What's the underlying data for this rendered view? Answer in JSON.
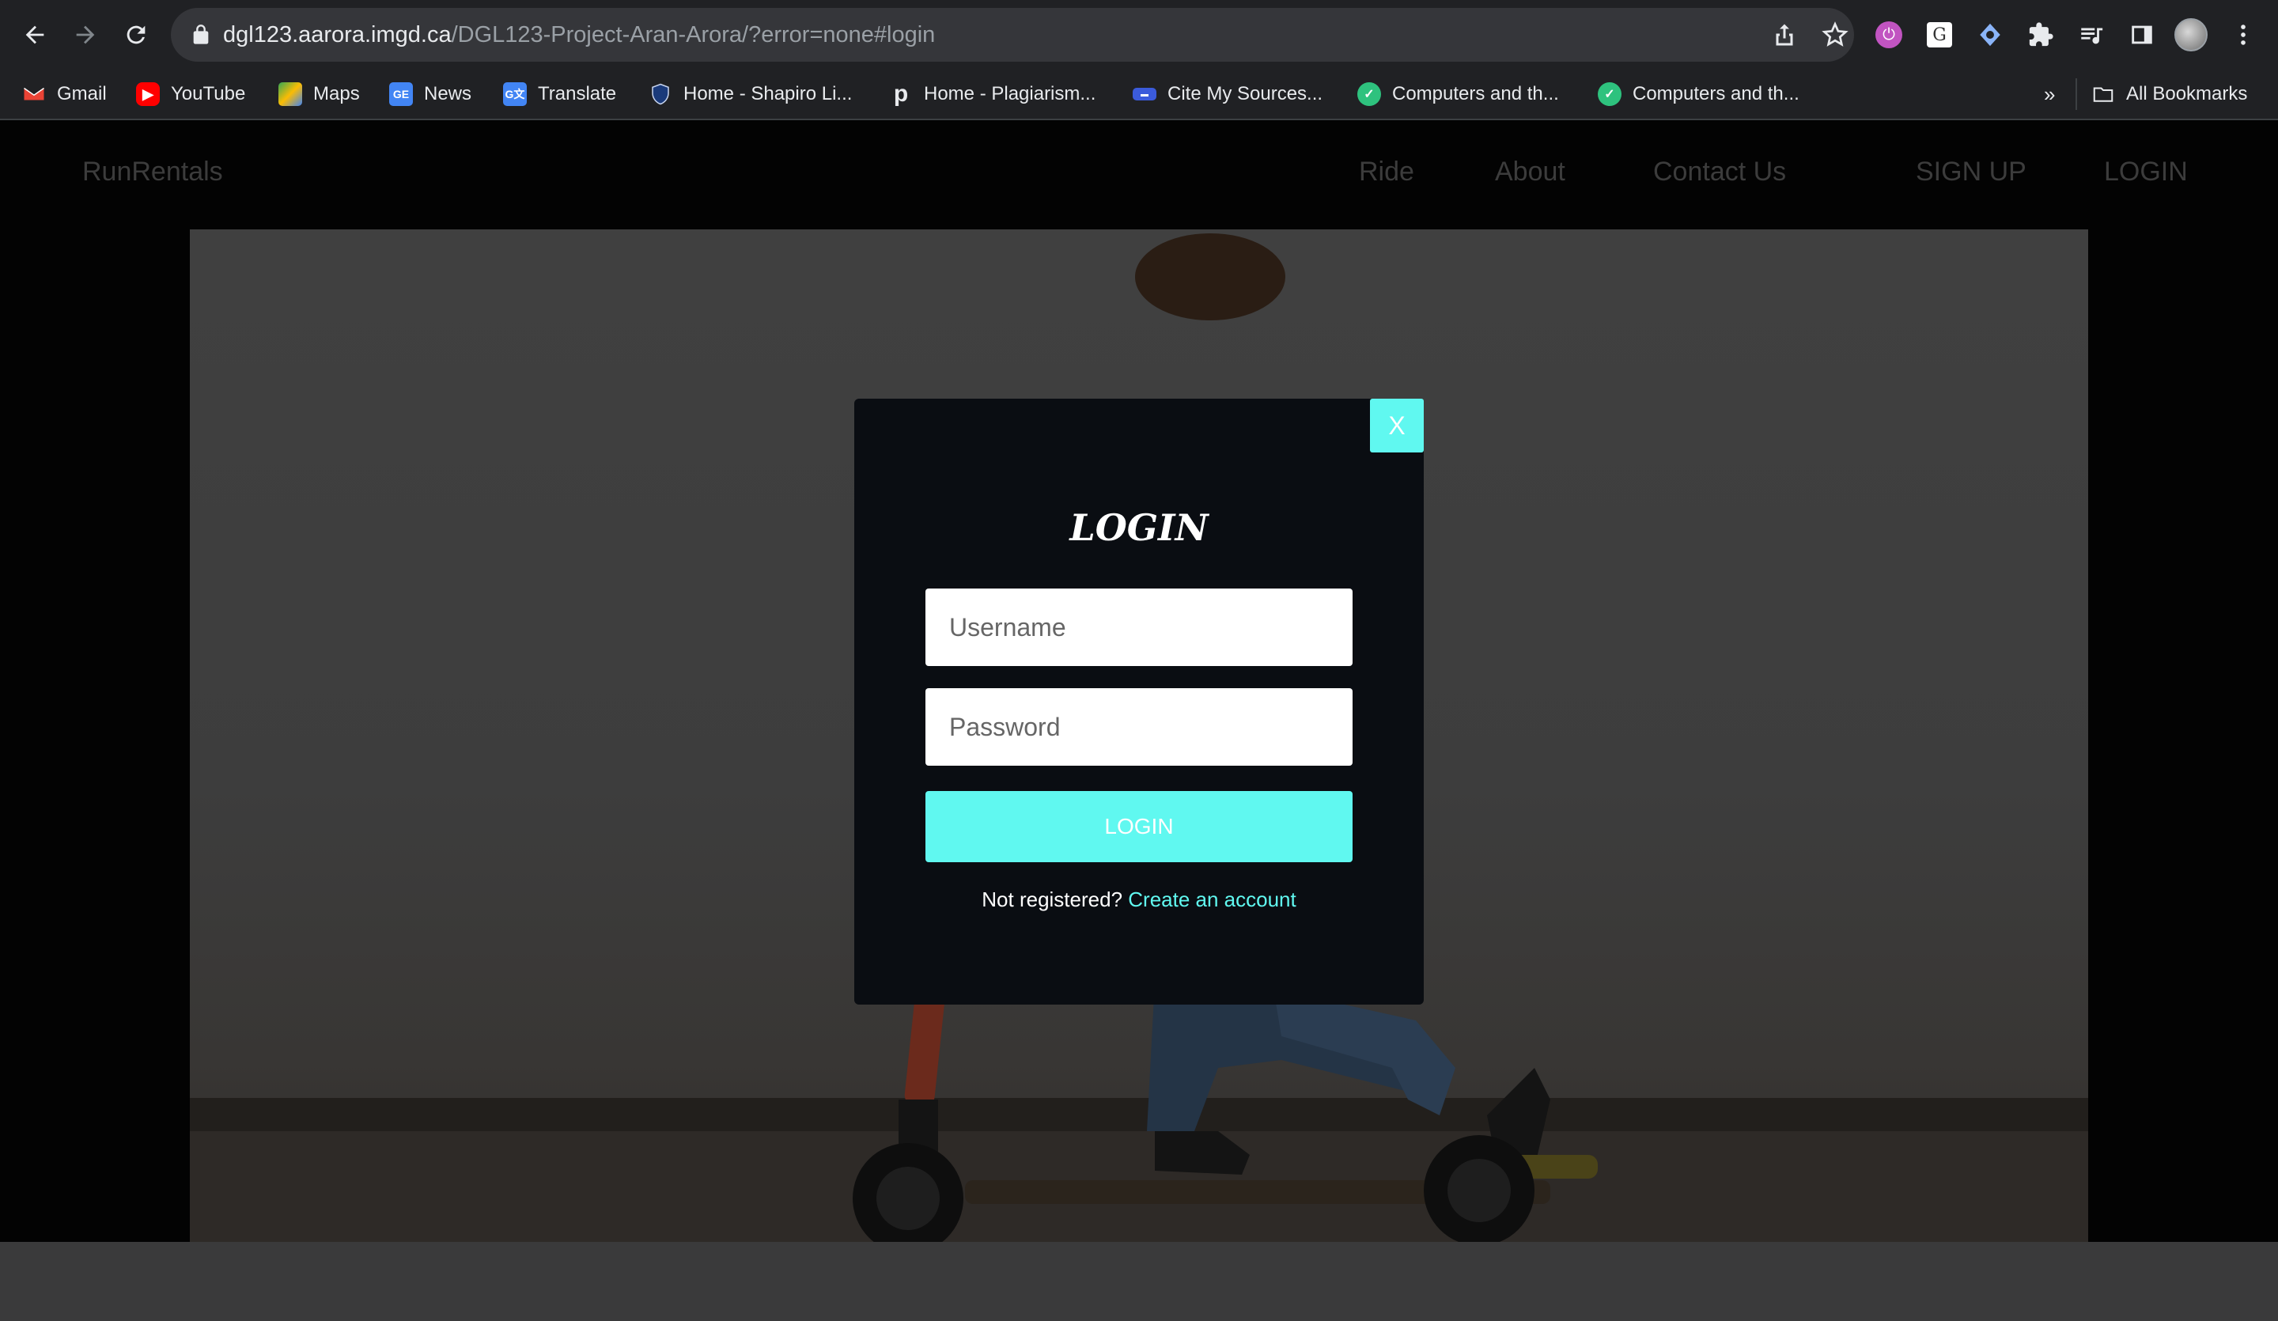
{
  "browser": {
    "url_host": "dgl123.aarora.imgd.ca",
    "url_path": "/DGL123-Project-Aran-Arora/?error=none#login",
    "bookmarks": [
      {
        "label": "Gmail",
        "icon": "gmail-icon"
      },
      {
        "label": "YouTube",
        "icon": "youtube-icon"
      },
      {
        "label": "Maps",
        "icon": "maps-icon"
      },
      {
        "label": "News",
        "icon": "news-icon"
      },
      {
        "label": "Translate",
        "icon": "translate-icon"
      },
      {
        "label": "Home - Shapiro Li...",
        "icon": "shield-icon"
      },
      {
        "label": "Home - Plagiarism...",
        "icon": "p-icon"
      },
      {
        "label": "Cite My Sources...",
        "icon": "cite-icon"
      },
      {
        "label": "Computers and th...",
        "icon": "shield-check-icon"
      },
      {
        "label": "Computers and th...",
        "icon": "shield-check-icon"
      }
    ],
    "overflow_label": "»",
    "all_bookmarks": "All Bookmarks"
  },
  "site": {
    "brand": "RunRentals",
    "nav": {
      "ride": "Ride",
      "about": "About",
      "contact": "Contact Us",
      "signup": "SIGN UP",
      "login": "LOGIN"
    }
  },
  "modal": {
    "close_label": "X",
    "title": "LOGIN",
    "username_placeholder": "Username",
    "password_placeholder": "Password",
    "submit_label": "LOGIN",
    "register_prompt": "Not registered?",
    "register_link": "Create an account"
  },
  "colors": {
    "accent": "#60f8f0",
    "modal_bg": "#0a0d12",
    "browser_bg": "#202124"
  }
}
